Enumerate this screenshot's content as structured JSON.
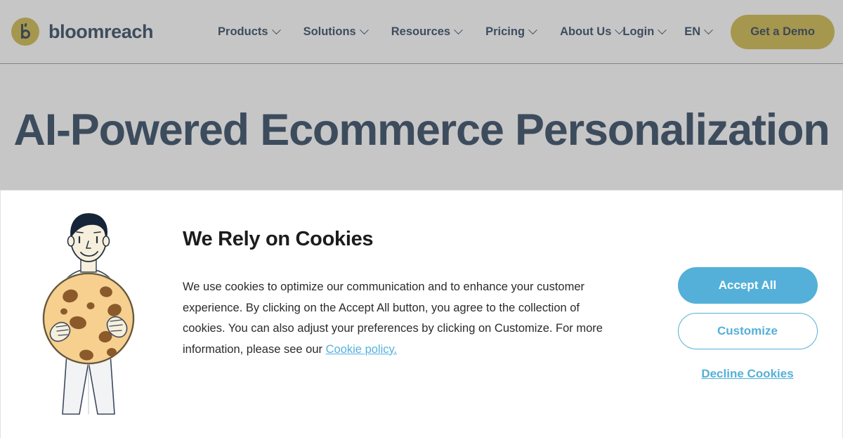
{
  "header": {
    "brand_name": "bloomreach",
    "brand_icon": "bloomreach-b-logo-icon",
    "nav": [
      {
        "label": "Products",
        "icon": "chevron-down-icon"
      },
      {
        "label": "Solutions",
        "icon": "chevron-down-icon"
      },
      {
        "label": "Resources",
        "icon": "chevron-down-icon"
      },
      {
        "label": "Pricing",
        "icon": "chevron-down-icon"
      },
      {
        "label": "About Us",
        "icon": "chevron-down-icon"
      }
    ],
    "login_label": "Login",
    "language_label": "EN",
    "demo_button_label": "Get a Demo"
  },
  "hero": {
    "heading": "AI-Powered Ecommerce Personalization"
  },
  "cookie_banner": {
    "illustration_name": "person-holding-cookie-illustration",
    "title": "We Rely on Cookies",
    "body_before_link": "We use cookies to optimize our communication and to enhance your customer experience. By clicking on the Accept All button, you agree to the collection of cookies. You can also adjust your preferences by clicking on Customize. For more information, please see our ",
    "link_label": "Cookie policy.",
    "accept_label": "Accept All",
    "customize_label": "Customize",
    "decline_label": "Decline Cookies"
  },
  "colors": {
    "brand_gold": "#c9ae33",
    "brand_navy": "#132e4a",
    "accent_blue": "#54b0d8",
    "overlay_gray": "#b3b3b3"
  }
}
